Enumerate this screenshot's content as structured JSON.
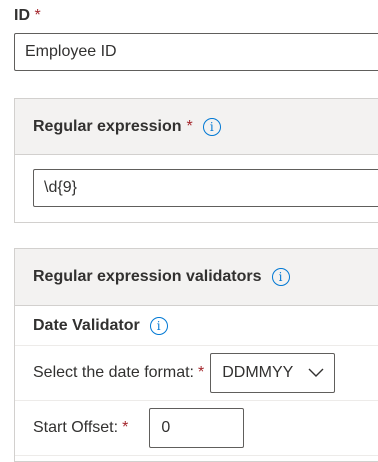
{
  "id_field": {
    "label": "ID",
    "required_mark": "*",
    "value": "Employee ID"
  },
  "regex_panel": {
    "title": "Regular expression",
    "required_mark": "*",
    "info_icon": "info-icon",
    "value": "\\d{9}"
  },
  "validators_panel": {
    "title": "Regular expression validators",
    "info_icon": "info-icon",
    "date_validator": {
      "title": "Date Validator",
      "info_icon": "info-icon",
      "date_format": {
        "label": "Select the date format:",
        "required_mark": "*",
        "selected": "DDMMYY"
      },
      "start_offset": {
        "label": "Start Offset:",
        "required_mark": "*",
        "value": "0"
      }
    }
  },
  "colors": {
    "accent": "#0078d4",
    "required": "#a4262c",
    "header_bg": "#f3f2f1",
    "text": "#323130"
  }
}
